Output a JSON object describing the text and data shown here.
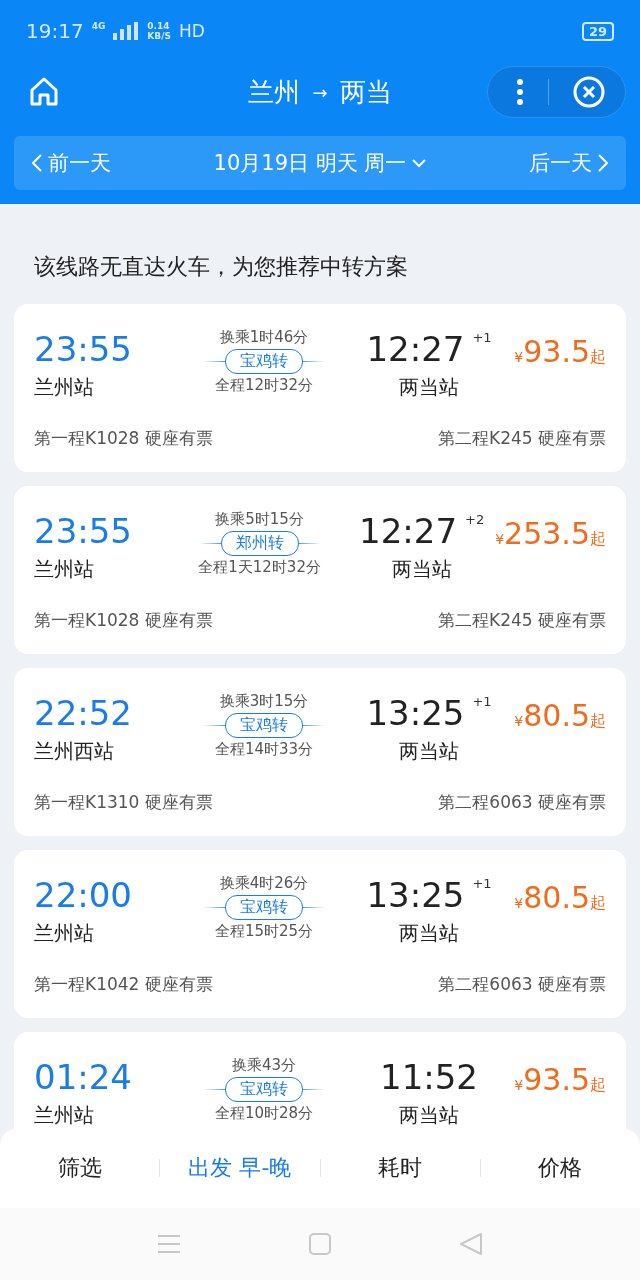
{
  "status_bar": {
    "time": "19:17",
    "network": "4G",
    "speed_value": "0.14",
    "speed_unit": "KB/S",
    "hd": "HD",
    "battery": "29"
  },
  "header": {
    "title_from": "兰州",
    "arrow": "→",
    "title_to": "两当"
  },
  "date_bar": {
    "prev": "前一天",
    "date": "10月19日 明天 周一",
    "next": "后一天"
  },
  "notice": "该线路无直达火车，为您推荐中转方案",
  "cards": [
    {
      "depart_time": "23:55",
      "depart_station": "兰州站",
      "transfer_wait": "换乘1时46分",
      "transfer_city": "宝鸡转",
      "total_duration": "全程12时32分",
      "arrive_time": "12:27",
      "day_offset": "+1",
      "arrive_station": "两当站",
      "price_symbol": "¥",
      "price": "93.5",
      "price_suffix": "起",
      "leg1": "第一程K1028 硬座有票",
      "leg2": "第二程K245 硬座有票"
    },
    {
      "depart_time": "23:55",
      "depart_station": "兰州站",
      "transfer_wait": "换乘5时15分",
      "transfer_city": "郑州转",
      "total_duration": "全程1天12时32分",
      "arrive_time": "12:27",
      "day_offset": "+2",
      "arrive_station": "两当站",
      "price_symbol": "¥",
      "price": "253.5",
      "price_suffix": "起",
      "leg1": "第一程K1028 硬座有票",
      "leg2": "第二程K245 硬座有票"
    },
    {
      "depart_time": "22:52",
      "depart_station": "兰州西站",
      "transfer_wait": "换乘3时15分",
      "transfer_city": "宝鸡转",
      "total_duration": "全程14时33分",
      "arrive_time": "13:25",
      "day_offset": "+1",
      "arrive_station": "两当站",
      "price_symbol": "¥",
      "price": "80.5",
      "price_suffix": "起",
      "leg1": "第一程K1310 硬座有票",
      "leg2": "第二程6063 硬座有票"
    },
    {
      "depart_time": "22:00",
      "depart_station": "兰州站",
      "transfer_wait": "换乘4时26分",
      "transfer_city": "宝鸡转",
      "total_duration": "全程15时25分",
      "arrive_time": "13:25",
      "day_offset": "+1",
      "arrive_station": "两当站",
      "price_symbol": "¥",
      "price": "80.5",
      "price_suffix": "起",
      "leg1": "第一程K1042 硬座有票",
      "leg2": "第二程6063 硬座有票"
    },
    {
      "depart_time": "01:24",
      "depart_station": "兰州站",
      "transfer_wait": "换乘43分",
      "transfer_city": "宝鸡转",
      "total_duration": "全程10时28分",
      "arrive_time": "11:52",
      "arrive_station": "两当站",
      "price_symbol": "¥",
      "price": "93.5",
      "price_suffix": "起"
    }
  ],
  "sort_tabs": [
    {
      "label": "筛选",
      "selected": false
    },
    {
      "label": "出发 早-晚",
      "selected": true
    },
    {
      "label": "耗时",
      "selected": false
    },
    {
      "label": "价格",
      "selected": false
    }
  ]
}
